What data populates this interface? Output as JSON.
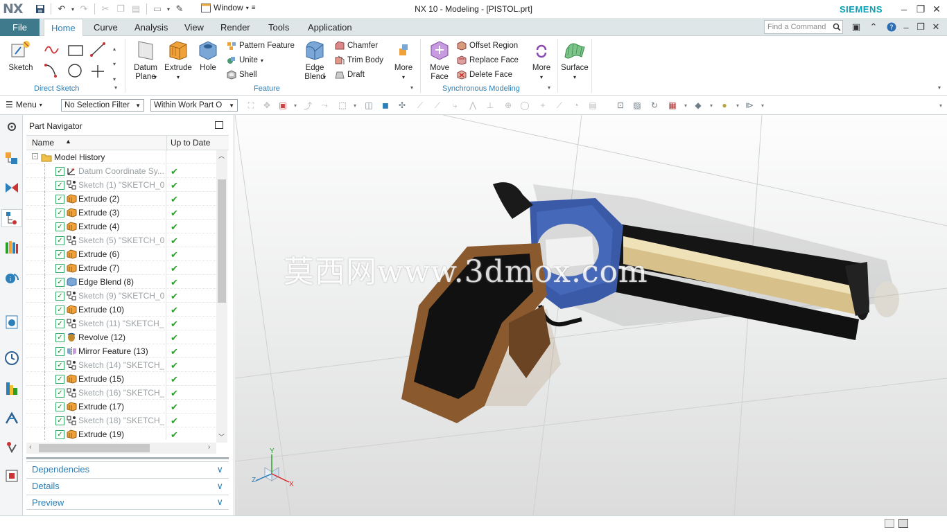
{
  "app": {
    "logo": "NX",
    "title": "NX 10 - Modeling - [PISTOL.prt]",
    "brand": "SIEMENS",
    "window_menu": "Window",
    "accent_color": "#3f7a8c",
    "link_color": "#2c7fb8"
  },
  "tabs": {
    "file": "File",
    "items": [
      "Home",
      "Curve",
      "Analysis",
      "View",
      "Render",
      "Tools",
      "Application"
    ],
    "active": "Home",
    "find_placeholder": "Find a Command"
  },
  "ribbon": {
    "direct_sketch": {
      "label": "Direct Sketch",
      "sketch": "Sketch"
    },
    "feature": {
      "label": "Feature",
      "datum_plane": "Datum Plane",
      "extrude": "Extrude",
      "hole": "Hole",
      "pattern_feature": "Pattern Feature",
      "unite": "Unite",
      "shell": "Shell",
      "edge_blend": "Edge Blend",
      "chamfer": "Chamfer",
      "trim_body": "Trim Body",
      "draft": "Draft",
      "more": "More"
    },
    "synchronous": {
      "label": "Synchronous Modeling",
      "move_face": "Move Face",
      "offset_region": "Offset Region",
      "replace_face": "Replace Face",
      "delete_face": "Delete Face",
      "more": "More"
    },
    "surface": "Surface"
  },
  "toolbar": {
    "menu": "Menu",
    "selection_filter": "No Selection Filter",
    "scope": "Within Work Part O"
  },
  "navigator": {
    "title": "Part Navigator",
    "col_name": "Name",
    "col_uptodate": "Up to Date",
    "root": "Model History",
    "rows": [
      {
        "name": "Datum Coordinate Sy...",
        "kind": "datum",
        "dim": true
      },
      {
        "name": "Sketch (1) \"SKETCH_0...",
        "kind": "sketch",
        "dim": true
      },
      {
        "name": "Extrude (2)",
        "kind": "extrude",
        "dim": false
      },
      {
        "name": "Extrude (3)",
        "kind": "extrude",
        "dim": false
      },
      {
        "name": "Extrude (4)",
        "kind": "extrude",
        "dim": false
      },
      {
        "name": "Sketch (5) \"SKETCH_0...",
        "kind": "sketch",
        "dim": true
      },
      {
        "name": "Extrude (6)",
        "kind": "extrude",
        "dim": false
      },
      {
        "name": "Extrude (7)",
        "kind": "extrude",
        "dim": false
      },
      {
        "name": "Edge Blend (8)",
        "kind": "blend",
        "dim": false
      },
      {
        "name": "Sketch (9) \"SKETCH_0...",
        "kind": "sketch",
        "dim": true
      },
      {
        "name": "Extrude (10)",
        "kind": "extrude",
        "dim": false
      },
      {
        "name": "Sketch (11) \"SKETCH_...",
        "kind": "sketch",
        "dim": true
      },
      {
        "name": "Revolve (12)",
        "kind": "revolve",
        "dim": false
      },
      {
        "name": "Mirror Feature (13)",
        "kind": "mirror",
        "dim": false
      },
      {
        "name": "Sketch (14) \"SKETCH_...",
        "kind": "sketch",
        "dim": true
      },
      {
        "name": "Extrude (15)",
        "kind": "extrude",
        "dim": false
      },
      {
        "name": "Sketch (16) \"SKETCH_...",
        "kind": "sketch",
        "dim": true
      },
      {
        "name": "Extrude (17)",
        "kind": "extrude",
        "dim": false
      },
      {
        "name": "Sketch (18) \"SKETCH_...",
        "kind": "sketch",
        "dim": true
      },
      {
        "name": "Extrude (19)",
        "kind": "extrude",
        "dim": false
      }
    ],
    "panes": [
      "Dependencies",
      "Details",
      "Preview"
    ]
  },
  "viewport": {
    "watermark": "莫西网www.3dmox.com",
    "triad": {
      "x": "X",
      "y": "Y",
      "z": "Z"
    }
  }
}
